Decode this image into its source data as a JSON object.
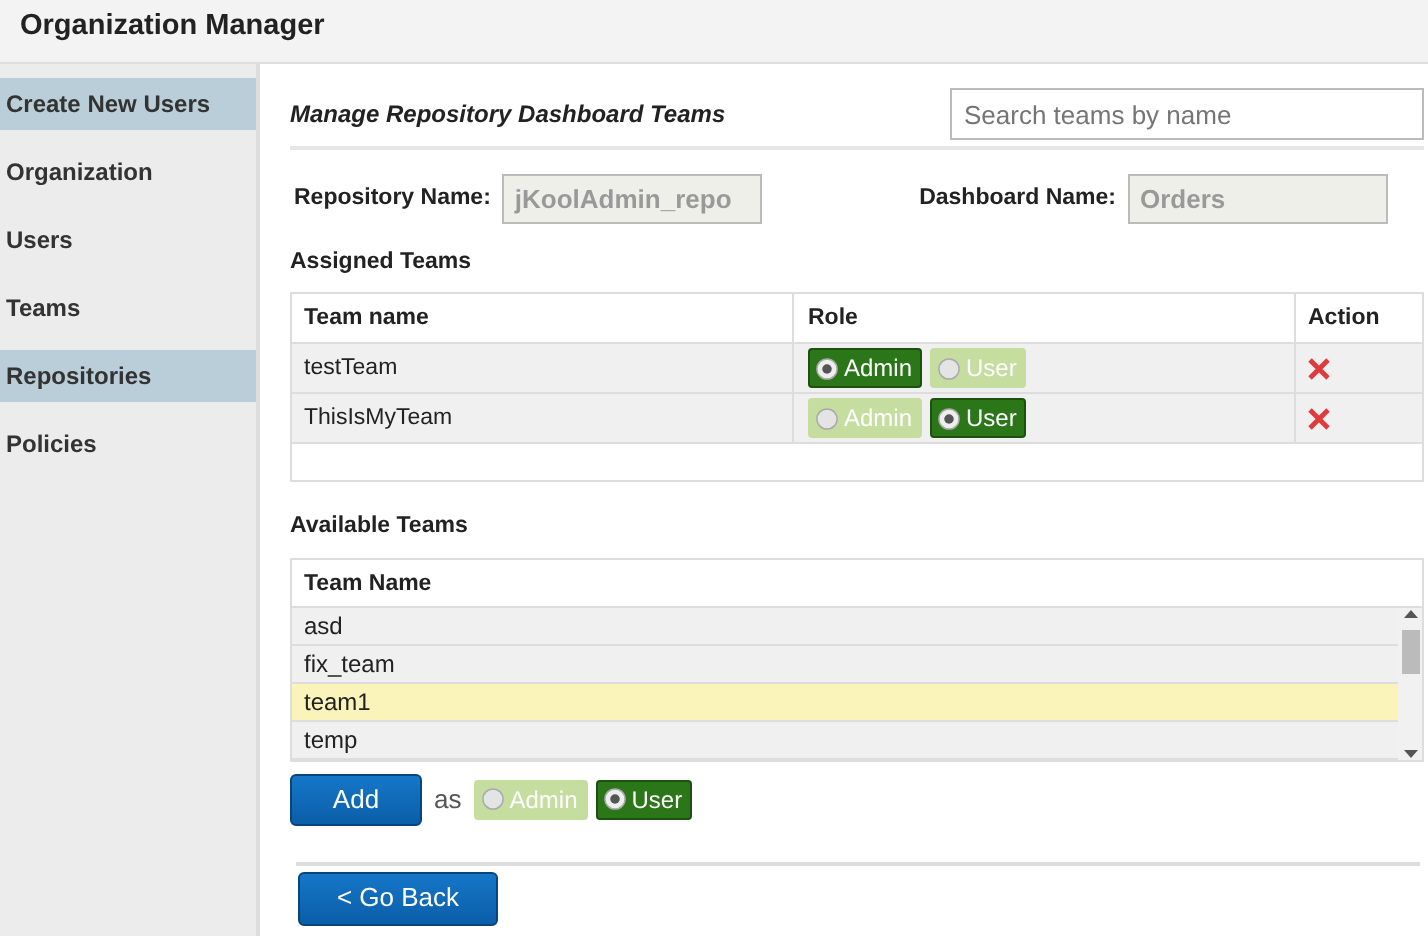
{
  "app_title": "Organization Manager",
  "sidebar": {
    "items": [
      {
        "label": "Create New Users",
        "selected": true
      },
      {
        "label": "Organization",
        "selected": false
      },
      {
        "label": "Users",
        "selected": false
      },
      {
        "label": "Teams",
        "selected": false
      },
      {
        "label": "Repositories",
        "selected": true
      },
      {
        "label": "Policies",
        "selected": false
      }
    ]
  },
  "main": {
    "title": "Manage Repository Dashboard Teams",
    "search": {
      "placeholder": "Search teams by name"
    },
    "fields": [
      {
        "label": "Repository Name:",
        "value": "jKoolAdmin_repo"
      },
      {
        "label": "Dashboard Name:",
        "value": "Orders"
      }
    ],
    "assigned": {
      "heading": "Assigned Teams",
      "columns": [
        "Team name",
        "Role",
        "Action"
      ],
      "rows": [
        {
          "team": "testTeam",
          "roles": [
            {
              "label": "Admin",
              "selected": true
            },
            {
              "label": "User",
              "selected": false
            }
          ]
        },
        {
          "team": "ThisIsMyTeam",
          "roles": [
            {
              "label": "Admin",
              "selected": false
            },
            {
              "label": "User",
              "selected": true
            }
          ]
        }
      ]
    },
    "available": {
      "heading": "Available Teams",
      "column": "Team Name",
      "rows": [
        {
          "name": "asd",
          "selected": false
        },
        {
          "name": "fix_team",
          "selected": false
        },
        {
          "name": "team1",
          "selected": true
        },
        {
          "name": "temp",
          "selected": false
        }
      ]
    },
    "add": {
      "button": "Add",
      "connector": "as",
      "roles": [
        {
          "label": "Admin",
          "selected": false
        },
        {
          "label": "User",
          "selected": true
        }
      ]
    },
    "back_button": "< Go Back"
  }
}
